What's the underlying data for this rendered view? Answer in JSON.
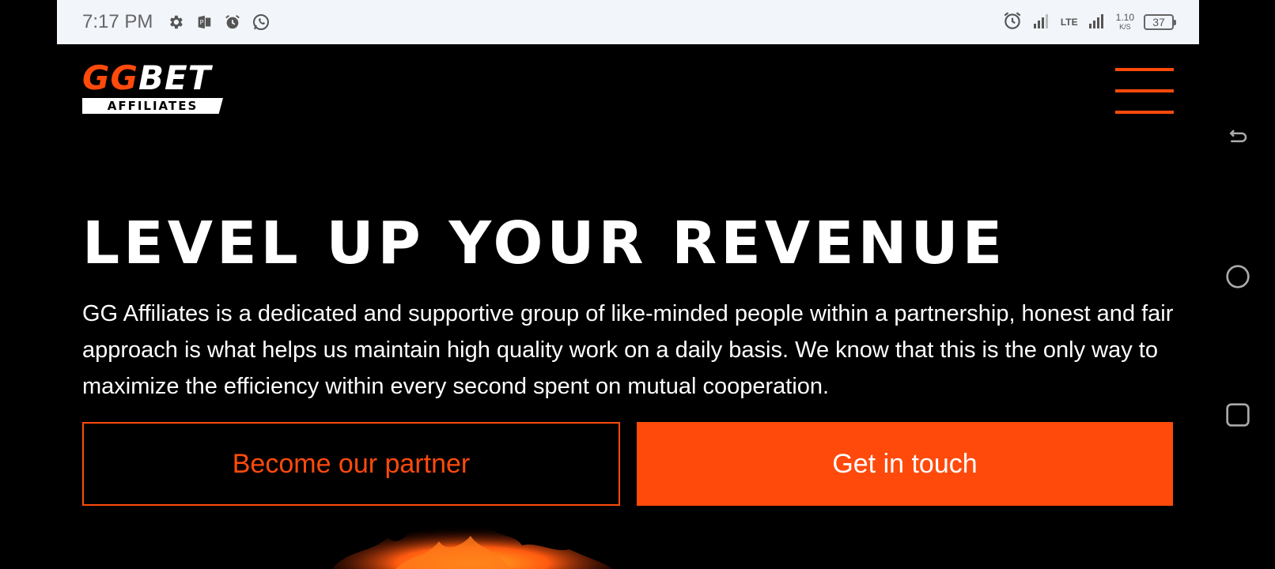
{
  "status_bar": {
    "time": "7:17 PM",
    "left_icons": [
      "gear-icon",
      "sim-icon",
      "alarm-icon",
      "whatsapp-icon"
    ],
    "network": "LTE",
    "speed_value": "1.10",
    "speed_unit": "K/S",
    "battery": "37"
  },
  "header": {
    "logo_top_gg": "GG",
    "logo_top_bet": "BET",
    "logo_bottom": "AFFILIATES",
    "menu_icon": "hamburger-menu-icon",
    "accent_color": "#ff4a0c"
  },
  "hero": {
    "title": "LEVEL UP YOUR REVENUE",
    "description": "GG Affiliates is a dedicated and supportive group of like-minded people within a partnership, honest and fair approach is what helps us maintain high quality work on a daily basis. We know that this is the only way to maximize the efficiency within every second spent on mutual cooperation.",
    "primary_button": "Become our partner",
    "secondary_button": "Get in touch"
  },
  "system_nav": [
    "back-icon",
    "home-icon",
    "recents-icon"
  ]
}
